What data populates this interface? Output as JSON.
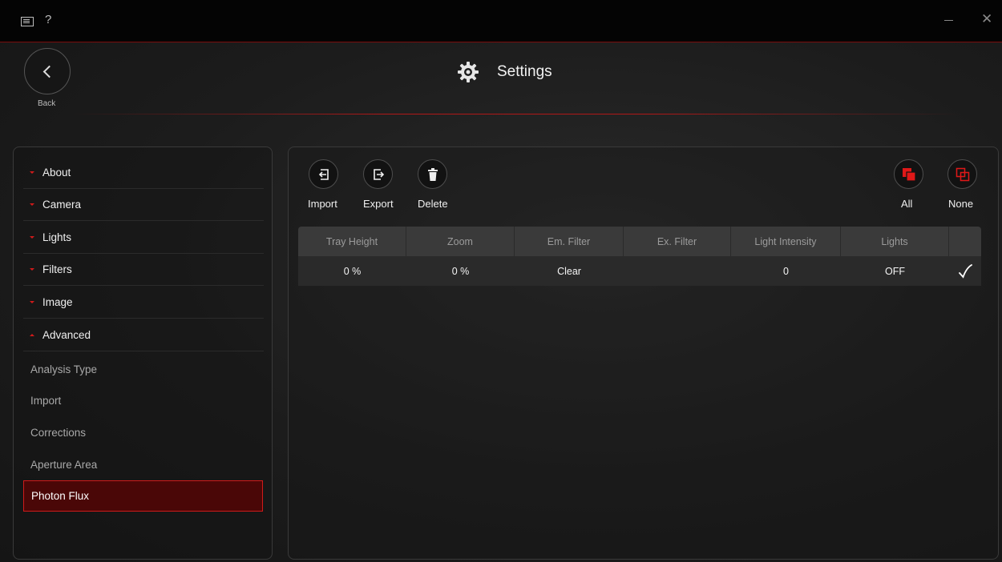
{
  "titlebar": {
    "help_label": "?"
  },
  "header": {
    "back_label": "Back",
    "title": "Settings"
  },
  "sidebar": {
    "sections": [
      {
        "label": "About"
      },
      {
        "label": "Camera"
      },
      {
        "label": "Lights"
      },
      {
        "label": "Filters"
      },
      {
        "label": "Image"
      },
      {
        "label": "Advanced"
      }
    ],
    "subitems": [
      {
        "label": "Analysis Type"
      },
      {
        "label": "Import"
      },
      {
        "label": "Corrections"
      },
      {
        "label": "Aperture Area"
      },
      {
        "label": "Photon Flux"
      }
    ],
    "active": "Photon Flux"
  },
  "toolbar": {
    "import_label": "Import",
    "export_label": "Export",
    "delete_label": "Delete",
    "all_label": "All",
    "none_label": "None"
  },
  "table": {
    "columns": [
      "Tray Height",
      "Zoom",
      "Em. Filter",
      "Ex. Filter",
      "Light Intensity",
      "Lights",
      ""
    ],
    "rows": [
      {
        "tray_height": "0 %",
        "zoom": "0 %",
        "em_filter": "Clear",
        "ex_filter": "",
        "light_intensity": "0",
        "lights": "OFF",
        "selected": true
      }
    ]
  },
  "colors": {
    "accent": "#d01a1a",
    "accent_dark": "#4a0707",
    "background": "#1c1c1c"
  }
}
